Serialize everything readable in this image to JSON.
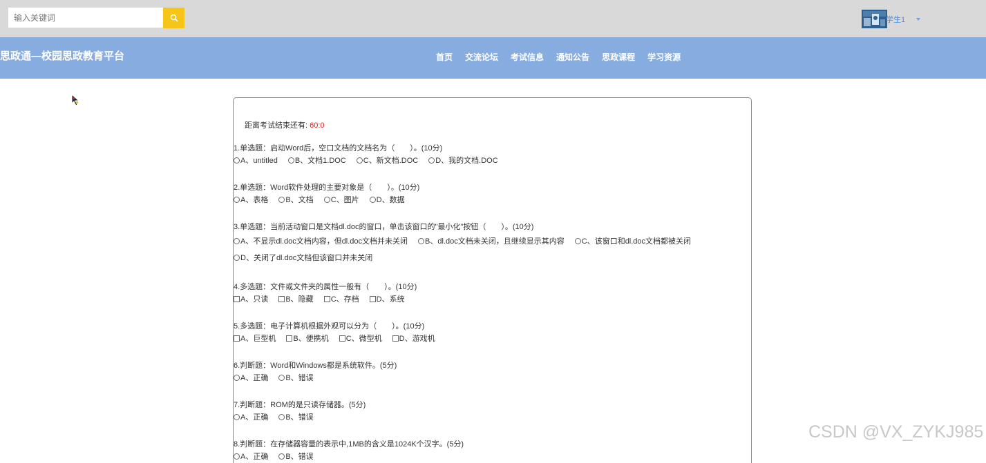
{
  "search": {
    "placeholder": "输入关键词"
  },
  "user": {
    "name": "学生1"
  },
  "brand": "思政通—校园思政教育平台",
  "nav": [
    "首页",
    "交流论坛",
    "考试信息",
    "通知公告",
    "思政课程",
    "学习资源"
  ],
  "exam": {
    "timer_label": "距离考试结束还有:",
    "timer_value": "60:0",
    "questions": [
      {
        "title": "1.单选题：启动Word后，空口文档的文档名为（　　）。(10分)",
        "type": "radio",
        "options": [
          "A、untitled",
          "B、文档1.DOC",
          "C、新文档.DOC",
          "D、我的文档.DOC"
        ]
      },
      {
        "title": "2.单选题：Word软件处理的主要对象是（　　）。(10分)",
        "type": "radio",
        "options": [
          "A、表格",
          "B、文档",
          "C、图片",
          "D、数据"
        ]
      },
      {
        "title": "3.单选题：当前活动窗口是文档dl.doc的窗口，单击该窗口的\"最小化\"按钮（　　）。(10分)",
        "type": "radio",
        "options": [
          "A、不显示dl.doc文档内容，但dl.doc文档并未关闭",
          "B、dl.doc文档未关闭，且继续显示其内容",
          "C、该窗口和dl.doc文档都被关闭",
          "D、关闭了dl.doc文档但该窗口并未关闭"
        ]
      },
      {
        "title": "4.多选题：文件或文件夹的属性一般有（　　）。(10分)",
        "type": "check",
        "options": [
          "A、只读",
          "B、隐藏",
          "C、存档",
          "D、系统"
        ]
      },
      {
        "title": "5.多选题：电子计算机根据外观可以分为（　　）。(10分)",
        "type": "check",
        "options": [
          "A、巨型机",
          "B、便携机",
          "C、微型机",
          "D、游戏机"
        ]
      },
      {
        "title": "6.判断题：Word和Windows都是系统软件。(5分)",
        "type": "radio",
        "options": [
          "A、正确",
          "B、错误"
        ]
      },
      {
        "title": "7.判断题：ROM的是只读存储器。(5分)",
        "type": "radio",
        "options": [
          "A、正确",
          "B、错误"
        ]
      },
      {
        "title": "8.判断题：在存储器容量的表示中,1MB的含义是1024K个汉字。(5分)",
        "type": "radio",
        "options": [
          "A、正确",
          "B、错误"
        ]
      }
    ]
  },
  "watermark": "CSDN @VX_ZYKJ985",
  "colors": {
    "topbar": "#d9d9d9",
    "navbar": "#87ade0",
    "search_button": "#f5c518",
    "timer": "#e02020",
    "username": "#4a90e2"
  },
  "icons": {
    "search": "search-icon",
    "user_menu": "chevron-down-icon"
  }
}
